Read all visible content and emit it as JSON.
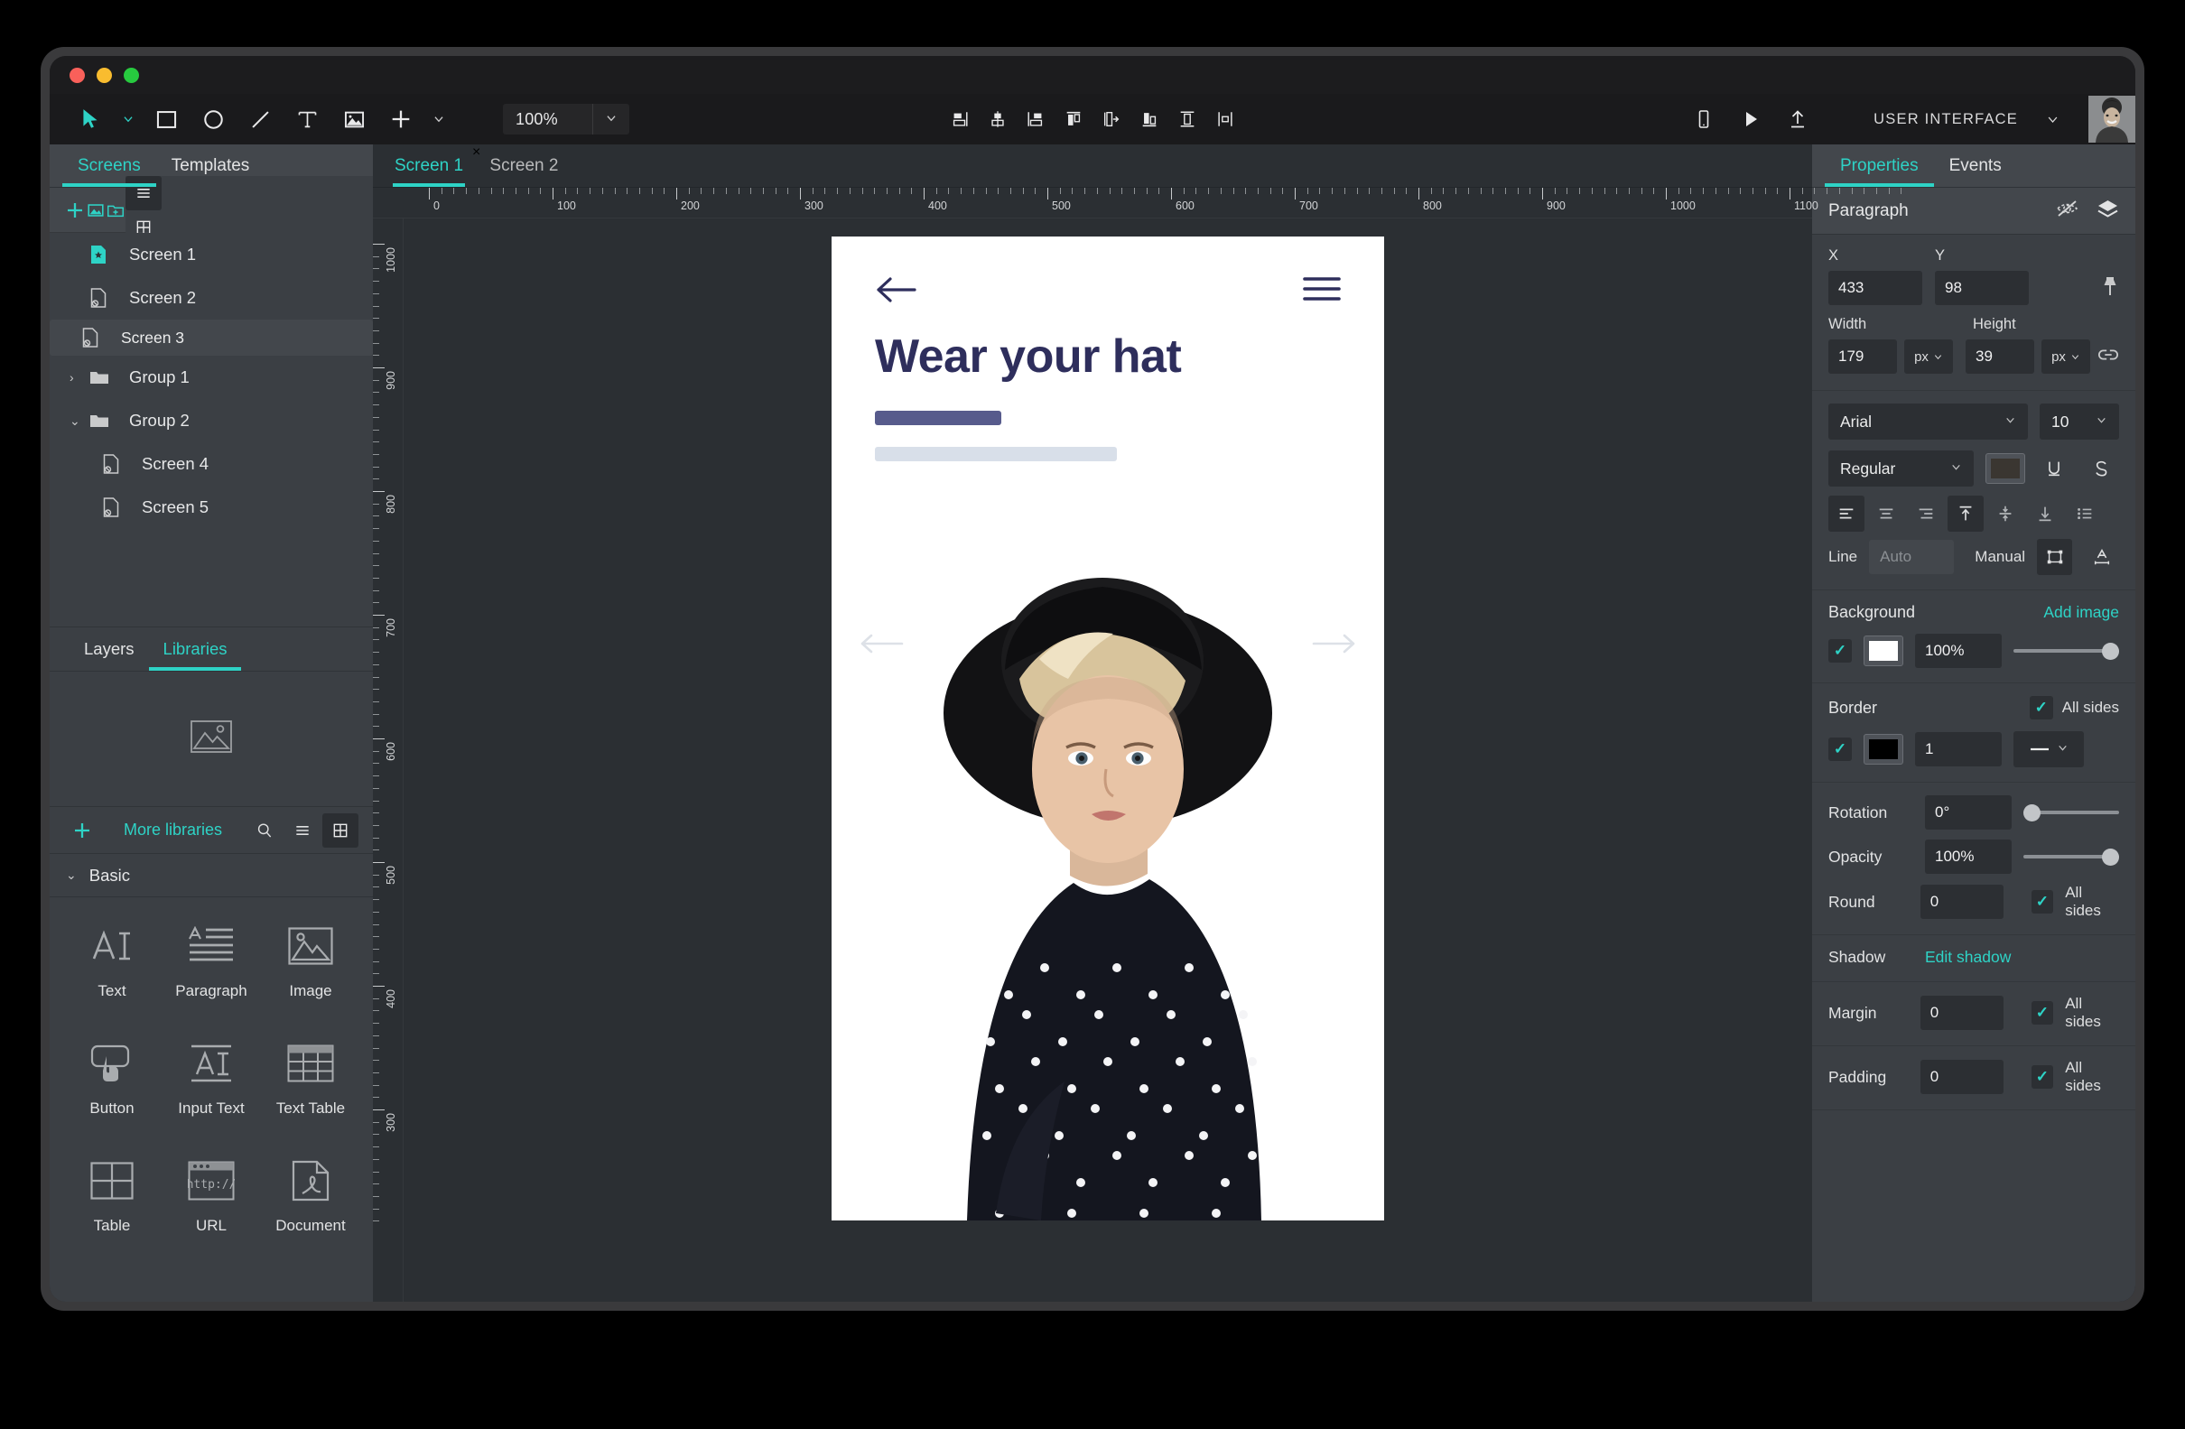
{
  "window": {
    "traffic_lights": [
      "close",
      "minimize",
      "maximize"
    ]
  },
  "toolbar": {
    "tools": [
      {
        "name": "select-tool",
        "icon": "cursor-arrow-icon"
      },
      {
        "name": "rectangle-tool",
        "icon": "square-icon"
      },
      {
        "name": "ellipse-tool",
        "icon": "circle-icon"
      },
      {
        "name": "line-tool",
        "icon": "line-icon"
      },
      {
        "name": "text-tool",
        "icon": "text-t-icon"
      },
      {
        "name": "image-tool",
        "icon": "image-icon"
      },
      {
        "name": "add-tool",
        "icon": "plus-icon"
      }
    ],
    "zoom": {
      "value": "100%"
    },
    "align_tools": [
      "align-left-icon",
      "align-center-horizontal-icon",
      "align-right-icon",
      "align-top-icon",
      "distribute-horizontal-icon",
      "align-bottom-icon",
      "align-middle-vertical-icon",
      "distribute-vertical-icon"
    ],
    "right_tools": [
      "mobile-preview-icon",
      "play-icon",
      "upload-icon"
    ],
    "project_label": "USER INTERFACE",
    "avatar_label": "user-avatar"
  },
  "left_panel": {
    "tabs": [
      {
        "label": "Screens",
        "active": true
      },
      {
        "label": "Templates",
        "active": false
      }
    ],
    "actions": [
      "add-screen-icon",
      "add-image-screen-icon",
      "add-group-icon"
    ],
    "view_modes": [
      "list-view-icon",
      "grid-view-icon"
    ],
    "screens": [
      {
        "label": "Screen 1",
        "icon": "screen-home-icon",
        "type": "screen",
        "selected": false,
        "indent": 0
      },
      {
        "label": "Screen 2",
        "icon": "screen-icon",
        "type": "screen",
        "selected": false,
        "indent": 0
      },
      {
        "label": "Screen 3",
        "icon": "screen-icon",
        "type": "screen",
        "selected": true,
        "indent": 0
      },
      {
        "label": "Group 1",
        "icon": "folder-icon",
        "type": "group",
        "chevron": "›",
        "selected": false,
        "indent": 0
      },
      {
        "label": "Group 2",
        "icon": "folder-icon",
        "type": "group",
        "chevron": "⌄",
        "selected": false,
        "indent": 0
      },
      {
        "label": "Screen 4",
        "icon": "screen-icon",
        "type": "screen",
        "selected": false,
        "indent": 1
      },
      {
        "label": "Screen 5",
        "icon": "screen-icon",
        "type": "screen",
        "selected": false,
        "indent": 1
      }
    ],
    "lower_tabs": [
      {
        "label": "Layers",
        "active": false
      },
      {
        "label": "Libraries",
        "active": true
      }
    ],
    "library_bar": {
      "add_label": "add-library-icon",
      "more_libraries": "More libraries",
      "search": "search-icon",
      "view_modes": [
        "list-view-icon",
        "grid-view-icon"
      ]
    },
    "category": {
      "label": "Basic",
      "chevron": "⌄"
    },
    "widgets": [
      {
        "label": "Text",
        "icon": "text-ai-icon"
      },
      {
        "label": "Paragraph",
        "icon": "paragraph-icon"
      },
      {
        "label": "Image",
        "icon": "image-icon"
      },
      {
        "label": "Button",
        "icon": "button-tap-icon"
      },
      {
        "label": "Input Text",
        "icon": "input-text-icon"
      },
      {
        "label": "Text Table",
        "icon": "text-table-icon"
      },
      {
        "label": "Table",
        "icon": "table-icon"
      },
      {
        "label": "URL",
        "icon": "url-browser-icon"
      },
      {
        "label": "Document",
        "icon": "pdf-document-icon"
      }
    ]
  },
  "canvas": {
    "tabs": [
      {
        "label": "Screen 1",
        "active": true,
        "closable": true,
        "close": "×"
      },
      {
        "label": "Screen 2",
        "active": false,
        "closable": false
      }
    ],
    "h_ruler_labels": [
      "0",
      "100",
      "200",
      "300",
      "400",
      "500",
      "600",
      "700",
      "800",
      "900",
      "1000",
      "1100"
    ],
    "v_ruler_labels": [
      "1000",
      "900",
      "800",
      "700",
      "600",
      "500",
      "400",
      "300"
    ],
    "artboard": {
      "back_icon": "back-arrow-icon",
      "menu_icon": "hamburger-menu-icon",
      "title": "Wear your hat",
      "prev_icon": "prev-arrow-icon",
      "next_icon": "next-arrow-icon",
      "title_color": "#2e2e5c",
      "accent_bar_color": "#575b8c",
      "muted_bar_color": "#d8dfe9",
      "photo_alt": "woman-wearing-black-hat-photo"
    }
  },
  "right_panel": {
    "tabs": [
      {
        "label": "Properties",
        "active": true
      },
      {
        "label": "Events",
        "active": false
      }
    ],
    "object": {
      "name": "Paragraph",
      "icons": [
        "hide-eye-icon",
        "layers-icon"
      ]
    },
    "geometry": {
      "x_label": "X",
      "x_value": "433",
      "y_label": "Y",
      "y_value": "98",
      "width_label": "Width",
      "width_value": "179",
      "width_unit": "px",
      "height_label": "Height",
      "height_value": "39",
      "height_unit": "px",
      "pin_icon": "pin-icon",
      "link_icon": "link-chain-icon"
    },
    "typography": {
      "font_family": "Arial",
      "font_size": "10",
      "font_weight": "Regular",
      "color_swatch": "#3a3631",
      "underline_icon": "underline-icon",
      "strikethrough_icon": "strikethrough-icon",
      "align_icons": [
        "align-text-left-icon",
        "align-text-center-icon",
        "align-text-right-icon",
        "valign-top-icon",
        "valign-middle-icon",
        "valign-bottom-icon",
        "list-bullets-icon"
      ],
      "line_label": "Line",
      "line_placeholder": "Auto",
      "manual_label": "Manual",
      "manual_icon": "bounding-box-icon",
      "letterspacing_icon": "letter-spacing-icon"
    },
    "background": {
      "label": "Background",
      "add_image": "Add image",
      "enabled": true,
      "color": "#ffffff",
      "opacity": "100%",
      "slider_pct": 100
    },
    "border": {
      "label": "Border",
      "all_sides_label": "All sides",
      "all_sides": true,
      "enabled": true,
      "color": "#000000",
      "width": "1",
      "style_icon": "solid-line-icon"
    },
    "transform": {
      "rotation_label": "Rotation",
      "rotation_value": "0°",
      "rotation_pct": 0,
      "opacity_label": "Opacity",
      "opacity_value": "100%",
      "opacity_pct": 100,
      "round_label": "Round",
      "round_value": "0",
      "round_all_sides_label": "All sides",
      "round_all_sides": true
    },
    "shadow": {
      "label": "Shadow",
      "action": "Edit shadow"
    },
    "spacing": [
      {
        "label": "Margin",
        "value": "0",
        "all_sides_label": "All sides",
        "all_sides": true
      },
      {
        "label": "Padding",
        "value": "0",
        "all_sides_label": "All sides",
        "all_sides": true
      }
    ]
  },
  "colors": {
    "accent": "#2ed3c6",
    "panel": "#3b3f44",
    "panel_alt": "#43474c",
    "toolbar": "#1a1a1c",
    "canvas": "#2b2f33"
  }
}
